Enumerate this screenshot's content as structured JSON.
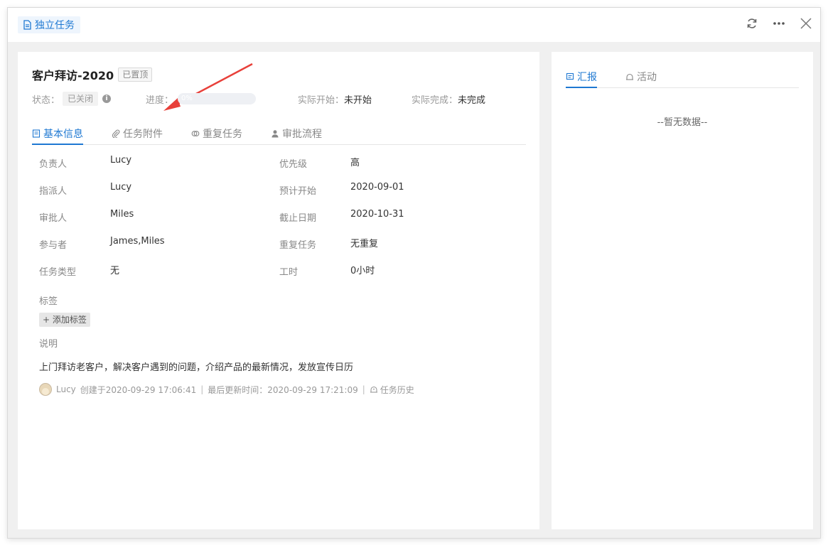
{
  "header": {
    "badge_label": "独立任务",
    "actions": [
      "refresh-icon",
      "more-icon",
      "close-icon"
    ]
  },
  "task": {
    "title": "客户拜访-2020",
    "pinned_label": "已置顶"
  },
  "status_row": {
    "status_label": "状态：",
    "status_value": "已关闭",
    "progress_label": "进度：",
    "progress_text": "0%",
    "progress_fraction": 0,
    "actual_start_label": "实际开始：",
    "actual_start_value": "未开始",
    "actual_end_label": "实际完成：",
    "actual_end_value": "未完成"
  },
  "tabs": [
    {
      "label": "基本信息",
      "icon": "document-icon",
      "active": true
    },
    {
      "label": "任务附件",
      "icon": "paperclip-icon",
      "active": false
    },
    {
      "label": "重复任务",
      "icon": "repeat-icon",
      "active": false
    },
    {
      "label": "审批流程",
      "icon": "user-icon",
      "active": false
    }
  ],
  "fields": [
    {
      "label": "负责人",
      "value": "Lucy"
    },
    {
      "label": "优先级",
      "value": "高"
    },
    {
      "label": "指派人",
      "value": "Lucy"
    },
    {
      "label": "预计开始",
      "value": "2020-09-01"
    },
    {
      "label": "审批人",
      "value": "Miles"
    },
    {
      "label": "截止日期",
      "value": "2020-10-31"
    },
    {
      "label": "参与者",
      "value": "James,Miles"
    },
    {
      "label": "重复任务",
      "value": "无重复"
    },
    {
      "label": "任务类型",
      "value": "无"
    },
    {
      "label": "工时",
      "value": "0小时"
    }
  ],
  "tags": {
    "label": "标签",
    "add_button": "+ 添加标签"
  },
  "description": {
    "label": "说明",
    "text": "上门拜访老客户，解决客户遇到的问题，介绍产品的最新情况，发放宣传日历"
  },
  "meta": {
    "creator": "Lucy",
    "created": "创建于2020-09-29 17:06:41",
    "separator": "|",
    "updated": "最后更新时间：2020-09-29 17:21:09",
    "history": "任务历史"
  },
  "right_tabs": [
    {
      "label": "汇报",
      "icon": "report-icon",
      "active": true
    },
    {
      "label": "活动",
      "icon": "activity-icon",
      "active": false
    }
  ],
  "right_empty": "--暂无数据--",
  "colors": {
    "accent": "#1e78d2",
    "annotation_arrow": "#e8403a"
  }
}
